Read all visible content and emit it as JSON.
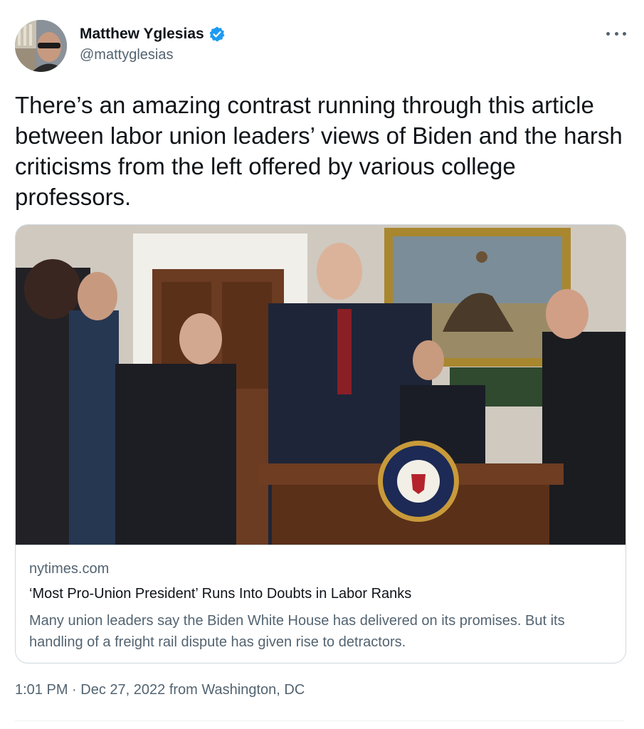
{
  "author": {
    "name": "Matthew Yglesias",
    "handle": "@mattyglesias",
    "verified": true
  },
  "tweet": {
    "text": "There’s an amazing contrast running through this article between labor union leaders’ views of Biden and the harsh criticisms from the left offered by various college professors."
  },
  "link_card": {
    "domain": "nytimes.com",
    "headline": "‘Most Pro-Union President’ Runs Into Doubts in Labor Ranks",
    "description": "Many union leaders say the Biden White House has delivered on its promises. But its handling of a freight rail dispute has given rise to detractors."
  },
  "meta": {
    "time": "1:01 PM",
    "separator": "·",
    "date": "Dec 27, 2022",
    "from_word": "from",
    "location": "Washington, DC"
  },
  "colors": {
    "text": "#0f1419",
    "secondary": "#536471",
    "verified": "#1d9bf0",
    "border": "#cfd9de"
  },
  "icons": [
    "verified-badge-icon",
    "more-options-icon"
  ]
}
